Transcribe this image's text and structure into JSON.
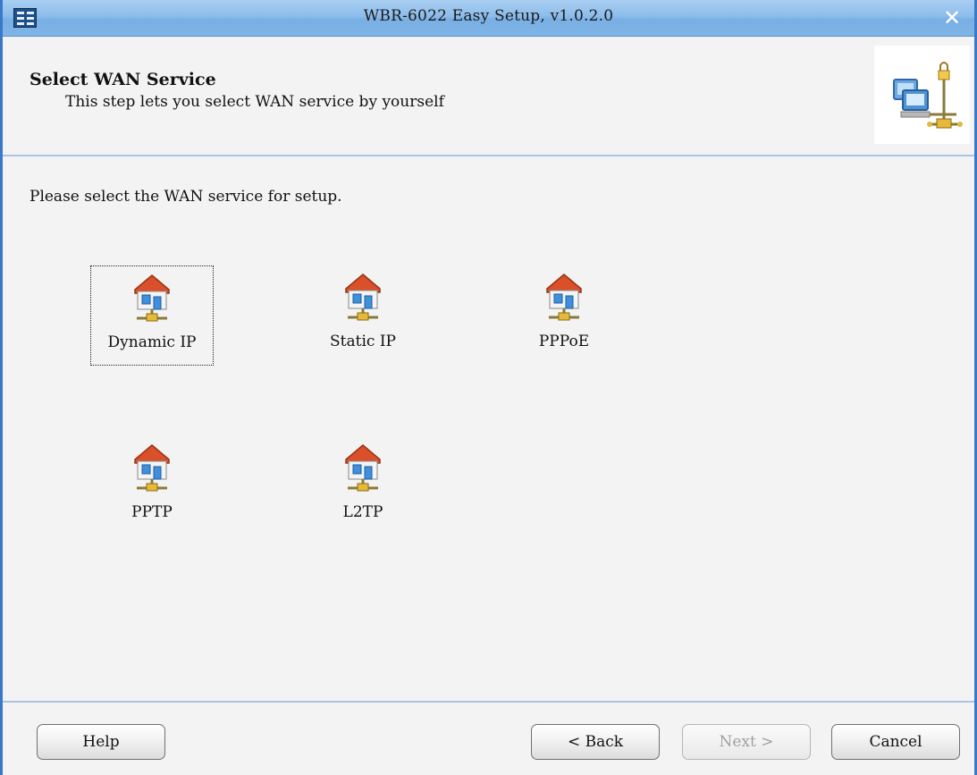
{
  "window": {
    "title": "WBR-6022 Easy Setup, v1.0.2.0",
    "close_symbol": "✕"
  },
  "header": {
    "title": "Select WAN Service",
    "subtitle": "This step lets you select WAN service by yourself",
    "icon": "network-computers-icon"
  },
  "instruction": "Please select the WAN service for setup.",
  "services": [
    {
      "label": "Dynamic IP",
      "icon": "house-network-icon",
      "selected": true
    },
    {
      "label": "Static IP",
      "icon": "house-network-icon",
      "selected": false
    },
    {
      "label": "PPPoE",
      "icon": "house-network-icon",
      "selected": false
    },
    {
      "label": "PPTP",
      "icon": "house-network-icon",
      "selected": false
    },
    {
      "label": "L2TP",
      "icon": "house-network-icon",
      "selected": false
    }
  ],
  "buttons": {
    "help": "Help",
    "back": "< Back",
    "next": "Next >",
    "cancel": "Cancel",
    "next_enabled": false
  },
  "colors": {
    "titlebar": "#8dbdea",
    "window_border": "#3a78c8",
    "separator": "#a8c6e4",
    "house_roof": "#d9502b"
  }
}
